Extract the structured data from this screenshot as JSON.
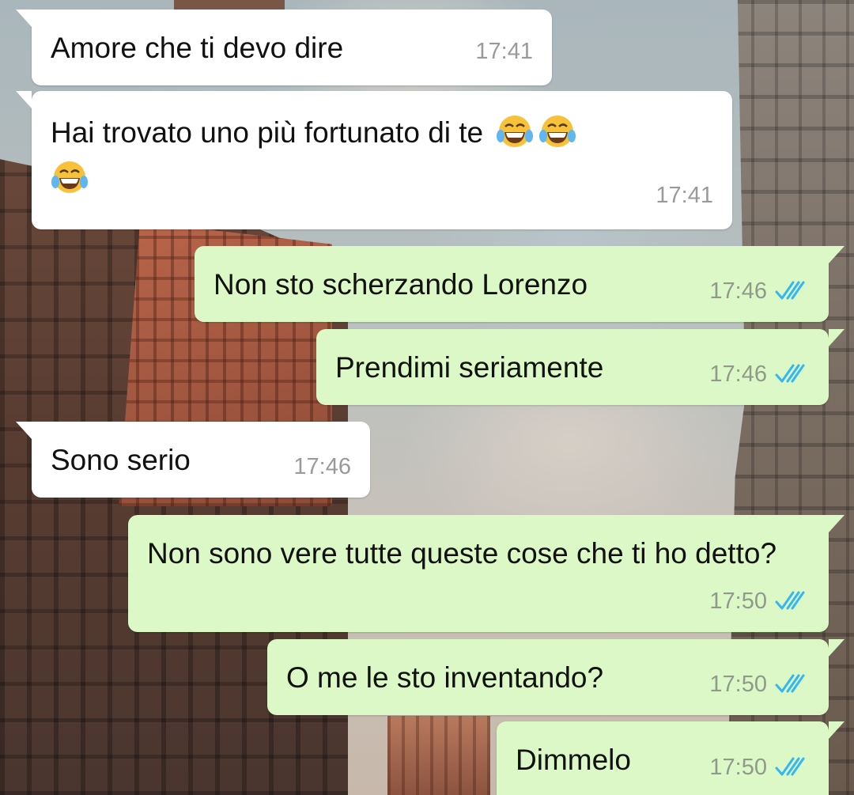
{
  "colors": {
    "incoming_bubble": "#ffffff",
    "outgoing_bubble": "#dcf8c6",
    "read_ticks": "#34b7f1",
    "timestamp": "#9a9a9a"
  },
  "messages": [
    {
      "direction": "in",
      "text": "Amore che ti devo dire",
      "time": "17:41"
    },
    {
      "direction": "in",
      "text": "Hai trovato uno più fortunato di te",
      "emoji": "face-with-tears-of-joy-icon",
      "emoji_count": 3,
      "time": "17:41"
    },
    {
      "direction": "out",
      "text": "Non sto scherzando Lorenzo",
      "time": "17:46",
      "status": "read"
    },
    {
      "direction": "out",
      "text": "Prendimi seriamente",
      "time": "17:46",
      "status": "read"
    },
    {
      "direction": "in",
      "text": "Sono serio",
      "time": "17:46"
    },
    {
      "direction": "out",
      "text": "Non sono vere tutte queste cose che ti ho detto?",
      "time": "17:50",
      "status": "read"
    },
    {
      "direction": "out",
      "text": "O me le sto inventando?",
      "time": "17:50",
      "status": "read"
    },
    {
      "direction": "out",
      "text": "Dimmelo",
      "time": "17:50",
      "status": "read"
    }
  ]
}
